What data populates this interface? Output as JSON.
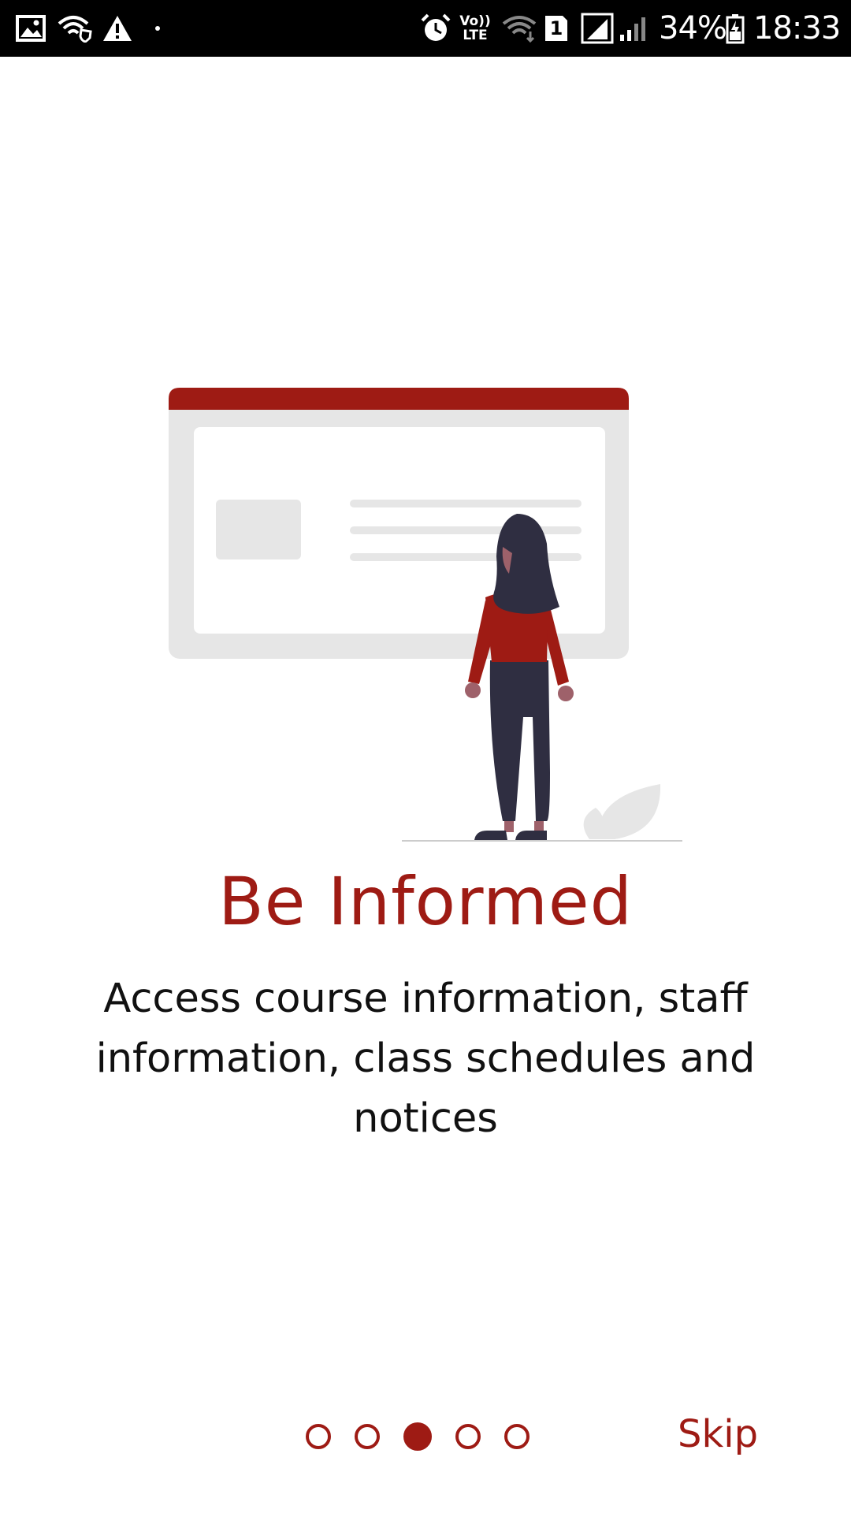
{
  "status_bar": {
    "battery_percent": "34%",
    "time": "18:33",
    "sim_slot": "1",
    "volte_top": "Vo))",
    "volte_bottom": "LTE",
    "icons": [
      "gallery-icon",
      "wifi-shield-icon",
      "warning-icon",
      "dot-icon",
      "alarm-icon",
      "volte-icon",
      "wifi-icon",
      "sim-icon",
      "signal-icon",
      "signal-weak-icon",
      "battery-charging-icon"
    ]
  },
  "onboarding": {
    "title": "Be Informed",
    "description": "Access course information, staff information, class schedules and notices",
    "pager": {
      "total": 5,
      "current": 3
    },
    "skip_label": "Skip"
  },
  "colors": {
    "accent": "#9e1b14",
    "figure_dark": "#2f2e41",
    "skin": "#9e616a",
    "panel_gray": "#e6e6e6",
    "text": "#111111"
  }
}
